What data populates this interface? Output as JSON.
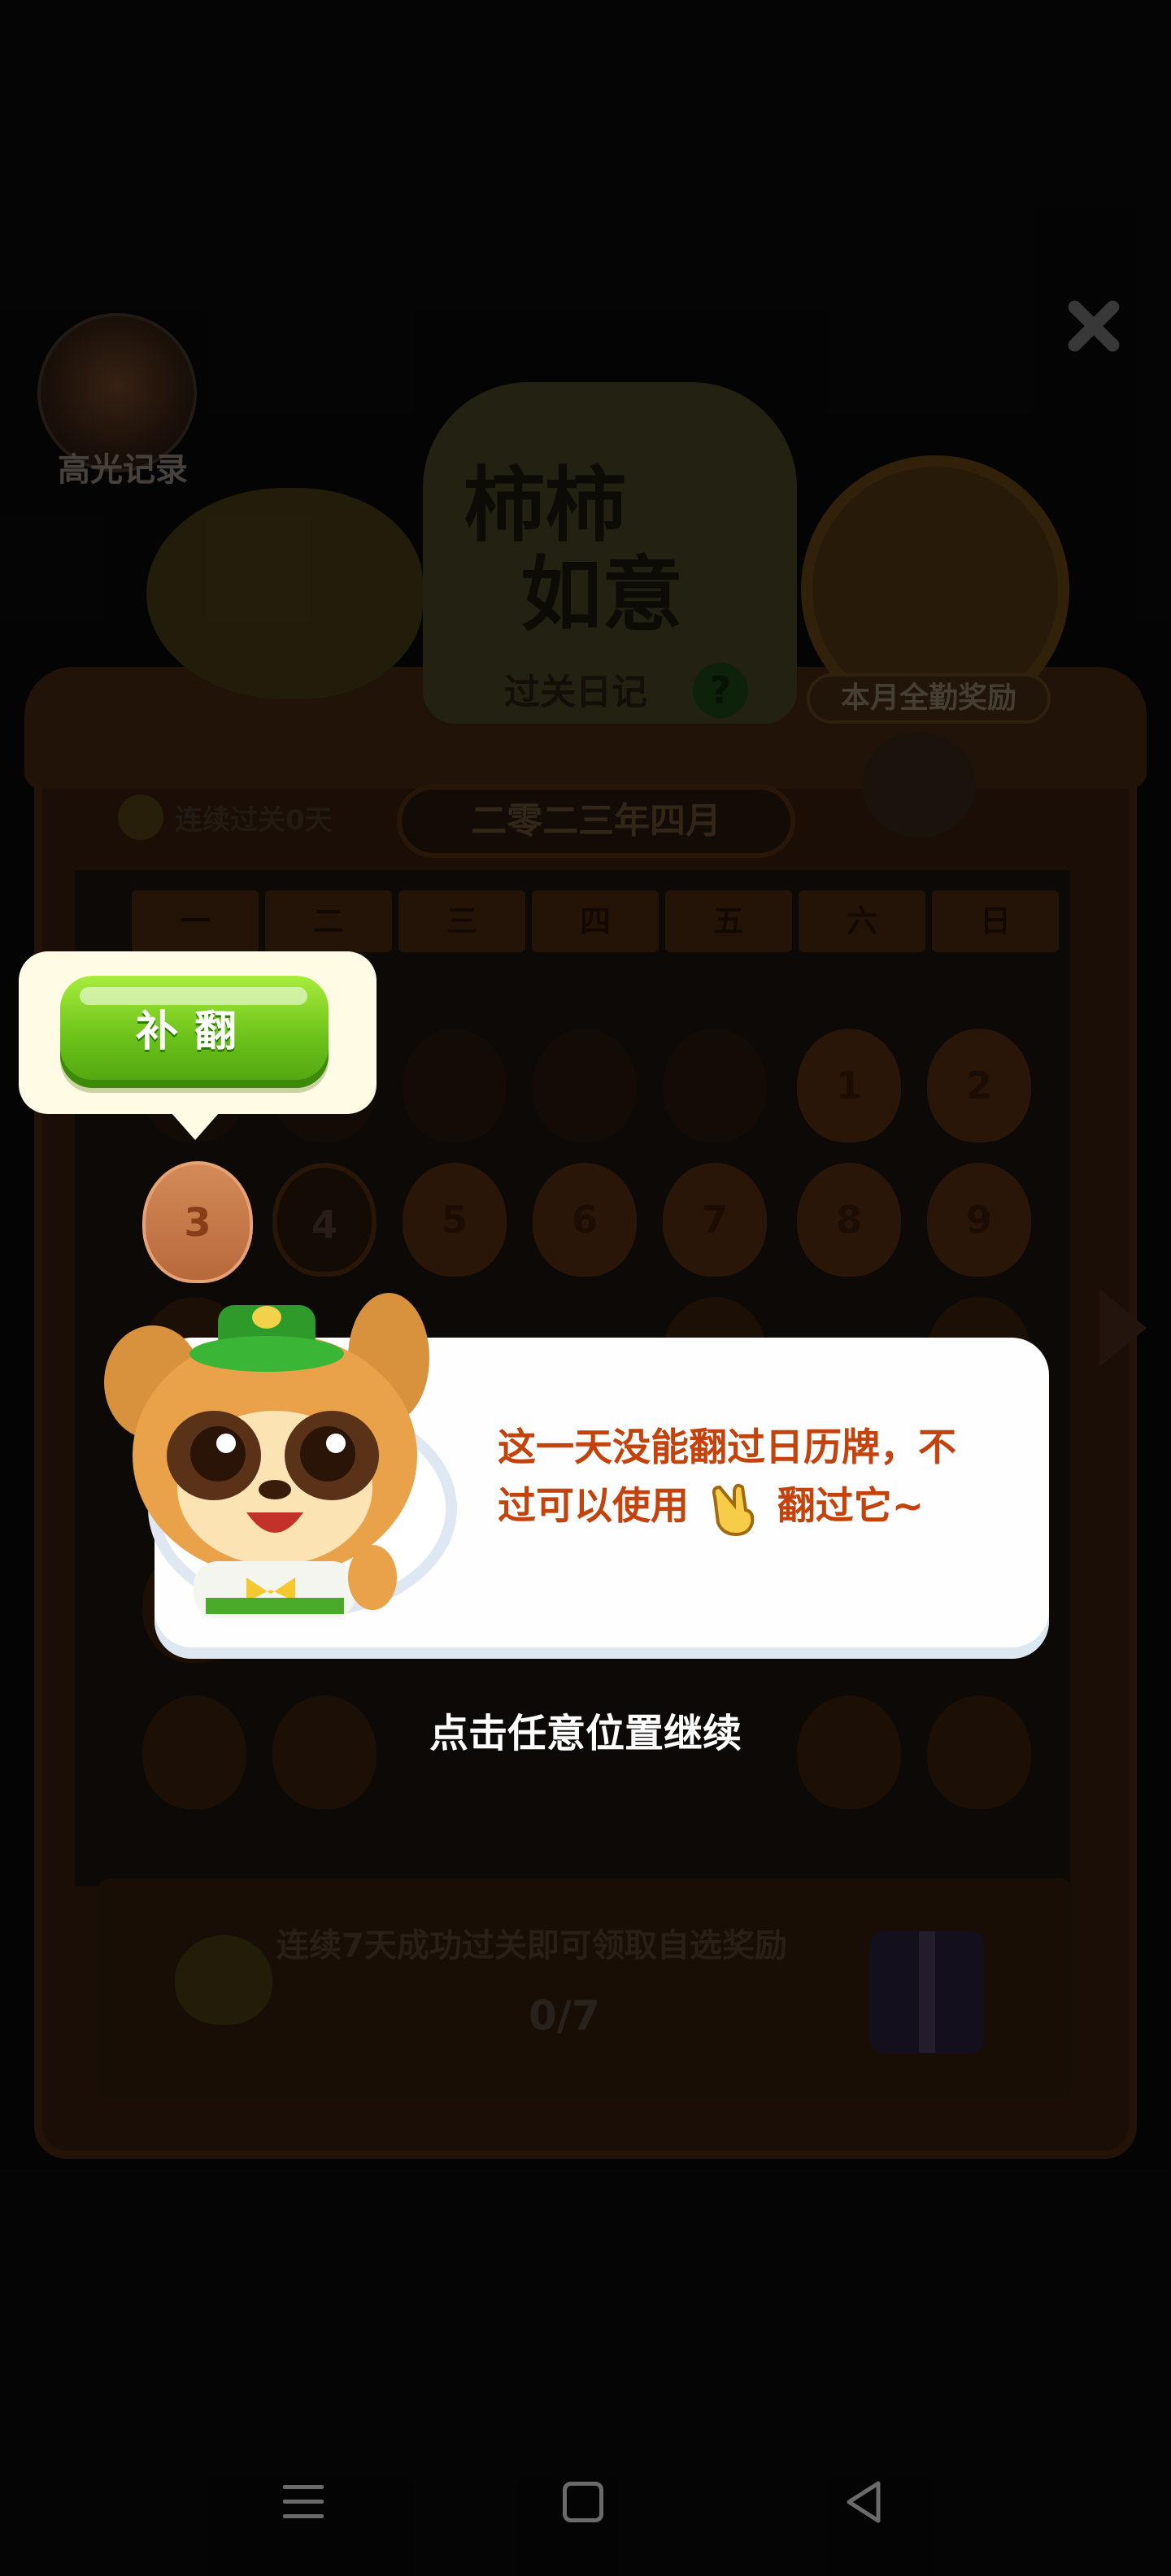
{
  "highlight_label": "高光记录",
  "title_line1": "柿柿",
  "title_line2": "如意",
  "diary_label": "过关日记",
  "monthly_reward_label": "本月全勤奖励",
  "streak_text": "连续过关0天",
  "month_label": "二零二三年四月",
  "weekdays": [
    "一",
    "二",
    "三",
    "四",
    "五",
    "六",
    "日"
  ],
  "days": {
    "d1": "1",
    "d2": "2",
    "d3": "3",
    "d4": "4",
    "d5": "5",
    "d6": "6",
    "d7": "7",
    "d8": "8",
    "d9": "9"
  },
  "tooltip_button": "补翻",
  "dialog_line1": "这一天没能翻过日历牌，不",
  "dialog_line2_a": "过可以使用",
  "dialog_line2_b": "翻过它~",
  "tap_hint": "点击任意位置继续",
  "reward_text": "连续7天成功过关即可领取自选奖励",
  "progress": "0/7",
  "colors": {
    "button_green": "#6cc21a",
    "dialog_text": "#c4420c",
    "tooltip_bg": "#fffbe4"
  },
  "icons": {
    "close": "close-icon",
    "help": "help-icon",
    "hand": "pointing-hand-icon",
    "gift": "gift-icon"
  }
}
